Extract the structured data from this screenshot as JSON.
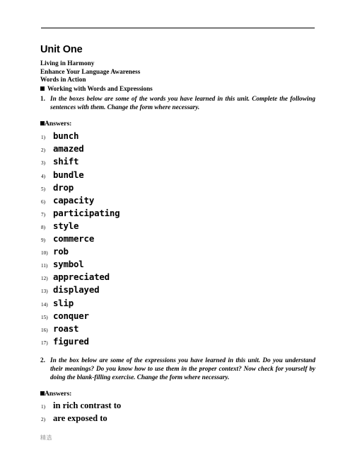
{
  "document": {
    "title": "Unit One",
    "subtitles": [
      "Living in Harmony",
      "Enhance Your Language Awareness",
      "Words in Action"
    ],
    "section_bullet_label": "Working with Words and Expressions",
    "answers_label": "Answers:",
    "footer_text": "精选"
  },
  "exercise1": {
    "number": "1.",
    "instruction": "In the boxes below are some of the words you have learned in this unit. Complete the following sentences with them. Change the form where necessary.",
    "answers": [
      {
        "index": "1)",
        "word": "bunch"
      },
      {
        "index": "2)",
        "word": "amazed"
      },
      {
        "index": "3)",
        "word": "shift"
      },
      {
        "index": "4)",
        "word": "bundle"
      },
      {
        "index": "5)",
        "word": "drop"
      },
      {
        "index": "6)",
        "word": "capacity"
      },
      {
        "index": "7)",
        "word": "participating"
      },
      {
        "index": "8)",
        "word": "style"
      },
      {
        "index": "9)",
        "word": "commerce"
      },
      {
        "index": "10)",
        "word": "rob"
      },
      {
        "index": "11)",
        "word": "symbol"
      },
      {
        "index": "12)",
        "word": "appreciated"
      },
      {
        "index": "13)",
        "word": "displayed"
      },
      {
        "index": "14)",
        "word": "slip"
      },
      {
        "index": "15)",
        "word": "conquer"
      },
      {
        "index": "16)",
        "word": "roast"
      },
      {
        "index": "17)",
        "word": "figured"
      }
    ]
  },
  "exercise2": {
    "number": "2.",
    "instruction": "In the box below are some of the expressions you have learned in this unit. Do you understand their meanings? Do you know how to use them in the proper context? Now check for yourself by doing the blank-filling exercise. Change the form where necessary.",
    "answers": [
      {
        "index": "1)",
        "word": "in rich contrast to"
      },
      {
        "index": "2)",
        "word": "are exposed to"
      }
    ]
  }
}
